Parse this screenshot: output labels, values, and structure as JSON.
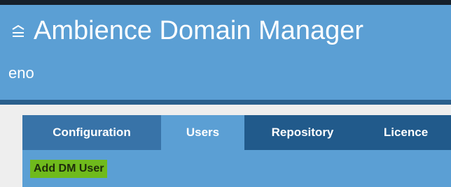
{
  "header": {
    "menu_icon": "menu-lines-icon",
    "title": "Ambience Domain Manager",
    "domain": "eno"
  },
  "tabs": [
    {
      "label": "Configuration",
      "active": false
    },
    {
      "label": "Users",
      "active": true
    },
    {
      "label": "Repository",
      "active": false
    },
    {
      "label": "Licence",
      "active": false
    }
  ],
  "toolbar": {
    "add_user_label": "Add DM User"
  },
  "colors": {
    "header": "#5b9fd4",
    "header_border": "#2a5f8c",
    "tab_bar": "#215a8b",
    "tab_configuration": "#3873a8",
    "highlight": "#6fba1c"
  }
}
